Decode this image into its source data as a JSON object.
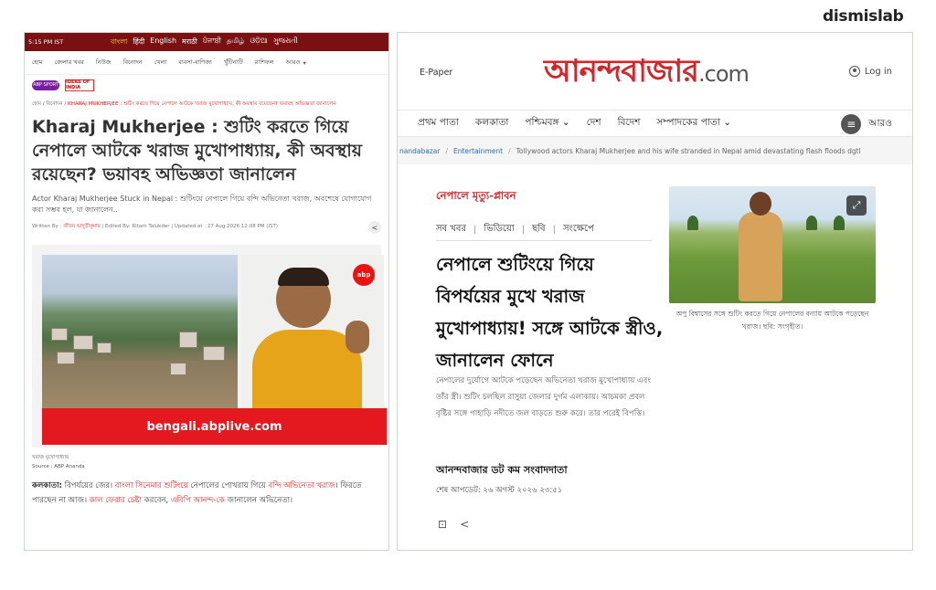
{
  "brand": "dismislab",
  "left": {
    "time": "5:15 PM IST",
    "languages": [
      "বাংলা",
      "हिंदी",
      "English",
      "मराठी",
      "ਪੰਜਾਬੀ",
      "தமிழ்",
      "ଓଡ଼ିଆ",
      "ગુજરાતી"
    ],
    "nav": [
      "হোম",
      "জেলার খবর",
      "নিউজ",
      "বিনোদন",
      "খেলা",
      "ব্যবসা-বাণিজ্য",
      "খুঁটিনাটি",
      "রাশিফল",
      "আরও"
    ],
    "logos": [
      "ABP SPORT",
      "IDEAS OF INDIA"
    ],
    "breadcrumb": {
      "prefix": "হোম / বিনোদন / ",
      "rest": "KHARAJ MUKHERJEE : শুটিং করতে গিয়ে নেপালে আটকে খরাজ মুখোপাধ্যায়, কী অবস্থায় রয়েছেন? ভয়াবহ অভিজ্ঞতা জানালেন"
    },
    "title": "Kharaj Mukherjee : শুটিং করতে গিয়ে নেপালে আটকে খরাজ মুখোপাধ্যায়, কী অবস্থায় রয়েছেন? ভয়াবহ অভিজ্ঞতা জানালেন",
    "subtitle": "Actor Kharaj Mukherjee Stuck in Nepal : শুটিংয়ে নেপালে গিয়ে বন্দি অভিনেতা খরাজ, অবশেষে যোগাযোগ করা সম্ভব হল, যা জানালেন..",
    "meta": {
      "written_label": "Written By : ",
      "written_name": "জীবন ভাদুড়ীকুমার",
      "edited": " | Edited By: Ritam Talukder | Updated at : 27 Aug 2026 12:08 PM (IST)"
    },
    "image_band": "bengali.abplive.com",
    "image_badge": "abp",
    "caption": "খরাজ মুখোপাধ্যায়",
    "source": "Source : ABP Ananda",
    "body": {
      "lead": "কলকাতা:",
      "p1": " বিপর্যয়ের জের। ",
      "r1": "বাংলা সিনেমার শুটিংয়ে",
      "p2": " নেপালের পোখরায় গিয়ে ",
      "r2": "বন্দি অভিনেতা খরাজ",
      "p3": "। ফিরতে পারছেন না আজ। ",
      "r3": "কাল ফেরার চেষ্টা",
      "p4": " করবেন, ",
      "r4": "এবিপি আনন্দ-কে",
      "p5": " জানালেন অভিনেতা।"
    }
  },
  "right": {
    "epaper": "E-Paper",
    "masthead": "আনন্দবাজার",
    "masthead_suffix": ".com",
    "login": "Log in",
    "nav": [
      "প্রথম পাতা",
      "কলকাতা",
      "পশ্চিমবঙ্গ ⌄",
      "দেশ",
      "বিদেশ",
      "সম্পাদকের পাতা ⌄"
    ],
    "nav_more": "আরও",
    "breadcrumb": [
      "nandabazar",
      "Entertainment",
      "Tollywood actors Kharaj Mukherjee and his wife stranded in Nepal amid devastating flash floods dgtl"
    ],
    "tag": "নেপালে মৃত্যু-প্লাবন",
    "subnav": [
      "সব খবর",
      "ভিডিয়ো",
      "ছবি",
      "সংক্ষেপে"
    ],
    "title": "নেপালে শুটিংয়ে গিয়ে বিপর্যয়ের মুখে খরাজ মুখোপাধ্যায়! সঙ্গে আটকে স্ত্রীও, জানালেন ফোনে",
    "summary": "নেপালের দুর্যোগে আটকে পড়েছেন অভিনেতা খরাজ মুখোপাধ্যায় এবং তাঁর স্ত্রী। শুটিং চলছিল রাসুয়া জেলার দুর্গম এলাকায়। আচমকা প্রবল বৃষ্টির সঙ্গে পাহাড়ি নদীতে জল বাড়তে শুরু করে। তার পরেই বিপত্তি।",
    "author": "আনন্দবাজার ডট কম সংবাদদাতা",
    "updated": "শেষ আপডেট: ২৬ অগস্ট ২০২৬ ২৩:৫১",
    "photo_caption": "অপু বিশ্বাসের সঙ্গে শুটিং করতে গিয়ে নেপালের বন্যায় আটকে পড়েছেন খরাজ। ছবি: সংগৃহীত।"
  }
}
